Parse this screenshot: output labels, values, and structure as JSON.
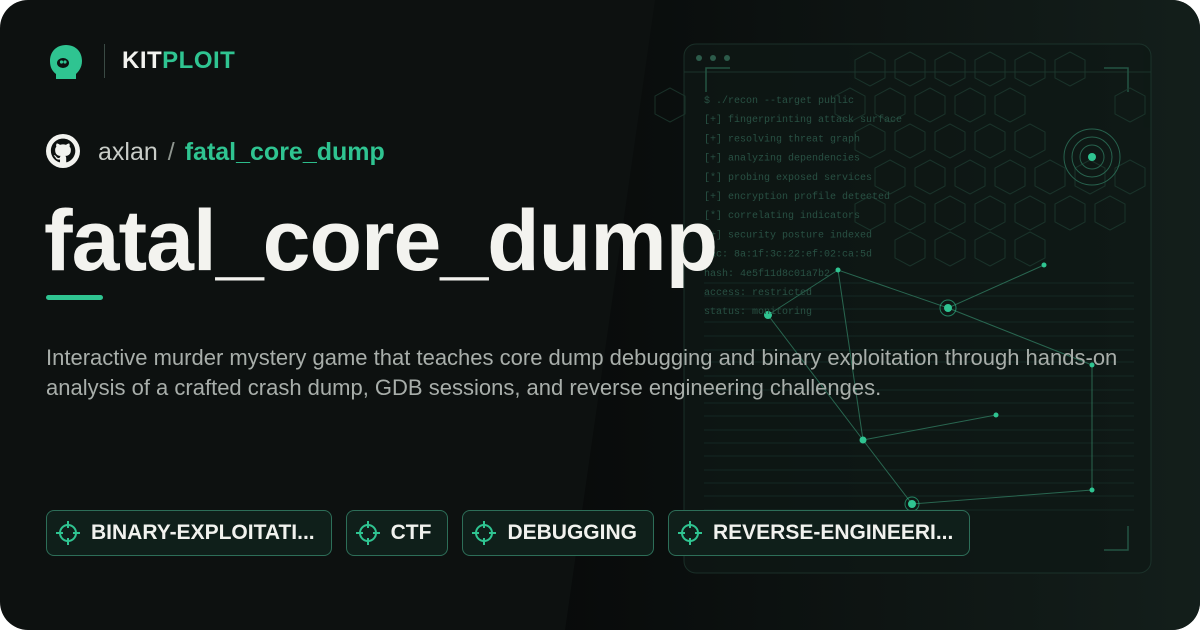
{
  "brand": {
    "name_part1": "KIT",
    "name_part2": "PLOIT"
  },
  "repo": {
    "owner": "axlan",
    "separator": "/",
    "name": "fatal_core_dump"
  },
  "title": "fatal_core_dump",
  "description": "Interactive murder mystery game that teaches core dump debugging and binary exploitation through hands-on analysis of a crafted crash dump, GDB sessions, and reverse engineering challenges.",
  "tags": [
    "BINARY-EXPLOITATI...",
    "CTF",
    "DEBUGGING",
    "REVERSE-ENGINEERI..."
  ],
  "terminal_lines": [
    "$ ./recon --target public",
    "[+] fingerprinting attack surface",
    "[+] resolving threat graph",
    "[+] analyzing dependencies",
    "[*] probing exposed services",
    "[+] encryption profile detected",
    "[*] correlating indicators",
    "[+] security posture indexed",
    "mac: 8a:1f:3c:22:ef:02:ca:5d",
    "hash: 4e5f11d8c01a7b2",
    "access: restricted",
    "status: monitoring"
  ],
  "colors": {
    "accent": "#2fc491",
    "background": "#0d1110",
    "text": "#f3f3ef",
    "muted": "#a8aeaa"
  },
  "icons": {
    "logo": "kitploit-mascot-icon",
    "owner": "github-icon",
    "tag": "crosshair-icon"
  }
}
